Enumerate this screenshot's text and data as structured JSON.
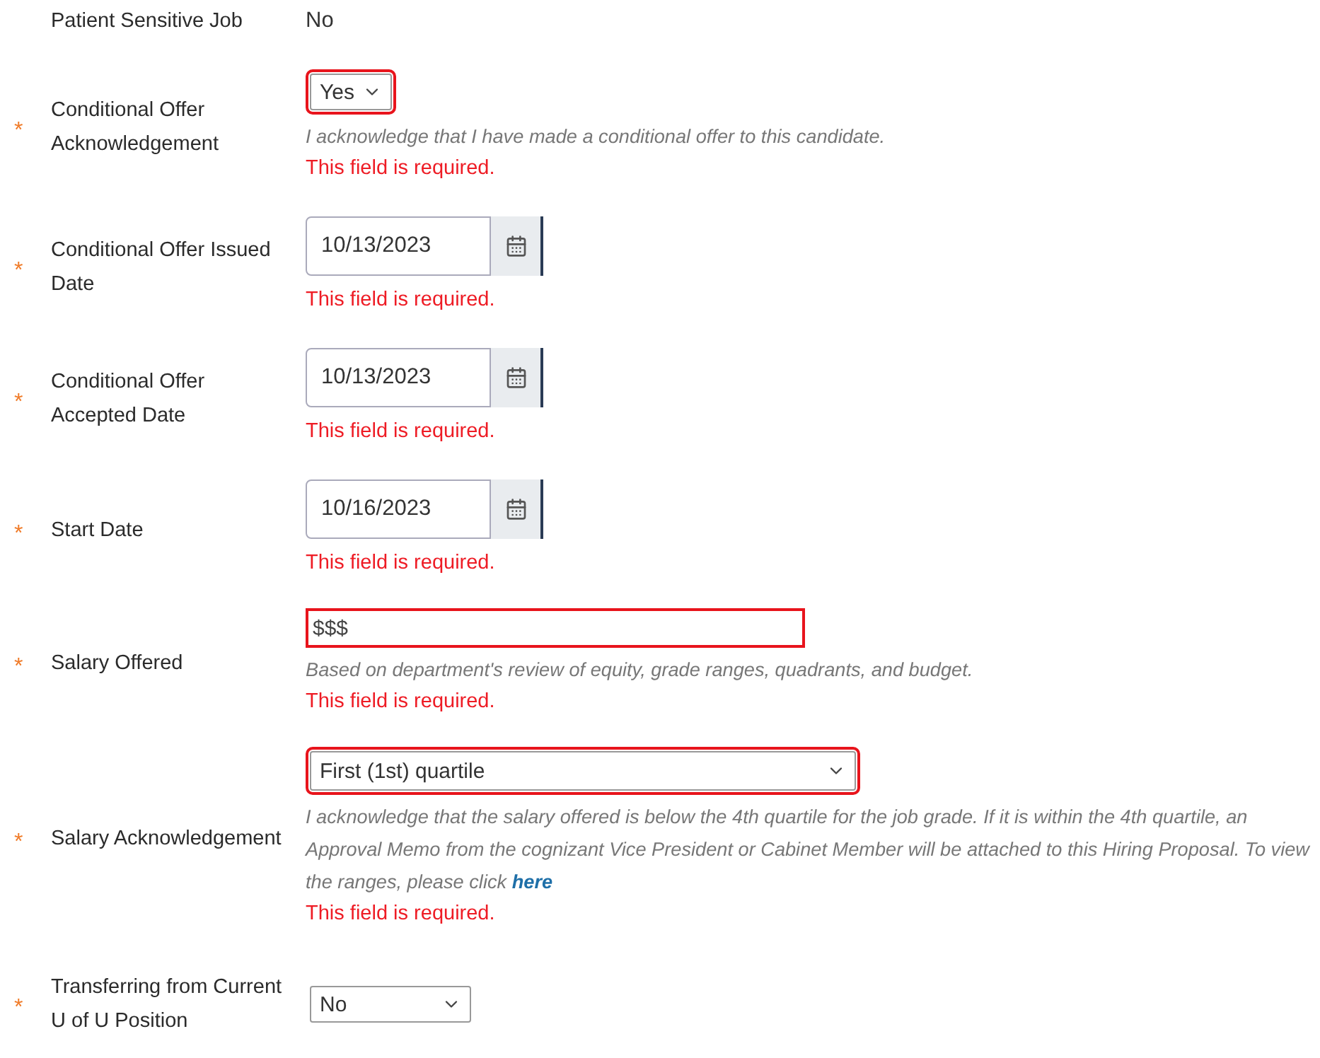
{
  "fields": [
    {
      "kind": "static",
      "label": "Patient Sensitive Job",
      "value": "No"
    },
    {
      "kind": "select",
      "required_mark": "*",
      "label": "Conditional Offer Acknowledgement",
      "value": "Yes",
      "invalid": true,
      "help": "I acknowledge that I have made a conditional offer to this candidate.",
      "error": "This field is required."
    },
    {
      "kind": "date",
      "required_mark": "*",
      "label": "Conditional Offer Issued Date",
      "value": "10/13/2023",
      "invalid": false,
      "error": "This field is required."
    },
    {
      "kind": "date",
      "required_mark": "*",
      "label": "Conditional Offer Accepted Date",
      "value": "10/13/2023",
      "invalid": false,
      "error": "This field is required."
    },
    {
      "kind": "date",
      "required_mark": "*",
      "label": "Start Date",
      "value": "10/16/2023",
      "invalid": false,
      "error": "This field is required."
    },
    {
      "kind": "text",
      "required_mark": "*",
      "label": "Salary Offered",
      "value": "$$$",
      "invalid": true,
      "help": "Based on department's review of equity, grade ranges, quadrants, and budget.",
      "error": "This field is required."
    },
    {
      "kind": "select",
      "required_mark": "*",
      "label": "Salary Acknowledgement",
      "value": "First (1st) quartile",
      "invalid": true,
      "help": "I acknowledge that the salary offered is below the 4th quartile for the job grade. If it is within the 4th quartile, an Approval Memo from the cognizant Vice President or Cabinet Member will be attached to this Hiring Proposal. To view the ranges, please click",
      "help_link": "here",
      "error": "This field is required."
    },
    {
      "kind": "select",
      "required_mark": "*",
      "label": "Transferring from Current U of U Position",
      "value": "No",
      "invalid": false
    }
  ]
}
